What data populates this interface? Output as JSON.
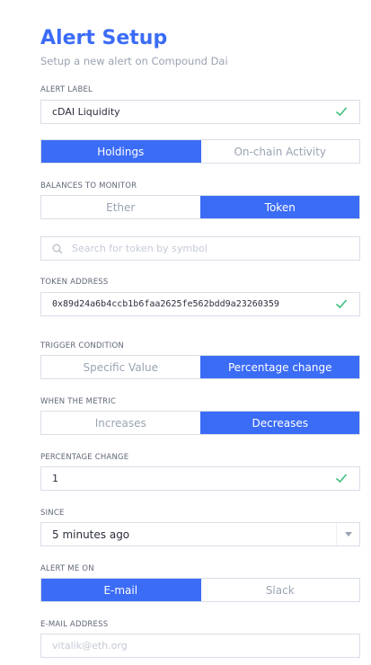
{
  "header": {
    "title": "Alert Setup",
    "subtitle": "Setup a new alert on Compound Dai"
  },
  "alert_label": {
    "label": "ALERT LABEL",
    "value": "cDAI Liquidity"
  },
  "type_toggle": {
    "options": [
      "Holdings",
      "On-chain Activity"
    ],
    "selected": "Holdings"
  },
  "balances": {
    "label": "BALANCES TO MONITOR",
    "options": [
      "Ether",
      "Token"
    ],
    "selected": "Token"
  },
  "token_search": {
    "placeholder": "Search for token by symbol"
  },
  "token_address": {
    "label": "TOKEN ADDRESS",
    "value": "0x89d24a6b4ccb1b6faa2625fe562bdd9a23260359"
  },
  "trigger": {
    "label": "TRIGGER CONDITION",
    "options": [
      "Specific Value",
      "Percentage change"
    ],
    "selected": "Percentage change"
  },
  "metric": {
    "label": "WHEN THE METRIC",
    "options": [
      "Increases",
      "Decreases"
    ],
    "selected": "Decreases"
  },
  "percentage": {
    "label": "PERCENTAGE CHANGE",
    "value": "1"
  },
  "since": {
    "label": "SINCE",
    "value": "5 minutes ago"
  },
  "alert_on": {
    "label": "ALERT ME ON",
    "options": [
      "E-mail",
      "Slack"
    ],
    "selected": "E-mail"
  },
  "email": {
    "label": "E-MAIL ADDRESS",
    "placeholder": "vitalik@eth.org"
  },
  "colors": {
    "accent": "#3b6cf6",
    "check": "#3fbf7f",
    "border": "#d9dee6"
  }
}
